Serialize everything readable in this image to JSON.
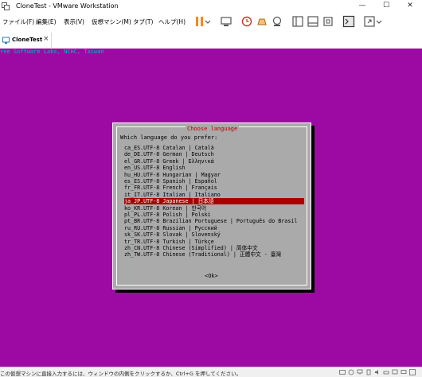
{
  "window": {
    "title": "CloneTest - VMware Workstation",
    "minimize": "—",
    "maximize": "☐",
    "close": "✕"
  },
  "menu": {
    "items": [
      "ファイル(F)",
      "編集(E)",
      "表示(V)",
      "仮想マシン(M)",
      "タブ(T)",
      "ヘルプ(H)"
    ]
  },
  "toolbar": {
    "icons": [
      "pause-icon",
      "dropdown-icon",
      "send-ctrl-alt-del-icon",
      "snapshot-icon",
      "revert-snapshot-icon",
      "manage-snapshots-icon",
      "show-library-icon",
      "thumbnail-icon",
      "fullscreen-icon",
      "console-view-icon",
      "unity-icon"
    ]
  },
  "tabs": [
    {
      "label": "CloneTest",
      "close": "×"
    }
  ],
  "vm": {
    "top_line": "ree Software Labs, NCHC, Taiwan",
    "dialog": {
      "title": "Choose language",
      "prompt": "Which language do you prefer:",
      "items": [
        "ca_ES.UTF-8 Catalan | Català",
        "de_DE.UTF-8 German | Deutsch",
        "el_GR.UTF-8 Greek | Ελληνικά",
        "en_US.UTF-8 English",
        "hu_HU.UTF-8 Hungarian | Magyar",
        "es_ES.UTF-8 Spanish | Español",
        "fr_FR.UTF-8 French | Français",
        "it_IT.UTF-8 Italian | Italiano",
        "ja_JP.UTF-8 Japanese | 日本語",
        "ko_KR.UTF-8 Korean | 한국어",
        "pl_PL.UTF-8 Polish | Polski",
        "pt_BR.UTF-8 Brazilian Portuguese | Português do Brasil",
        "ru_RU.UTF-8 Russian | Русский",
        "sk_SK.UTF-8 Slovak | Slovenský",
        "tr_TR.UTF-8 Turkish | Türkçe",
        "zh_CN.UTF-8 Chinese (Simplified) | 简体中文",
        "zh_TW.UTF-8 Chinese (Traditional) | 正體中文 - 臺灣"
      ],
      "selected_index": 8,
      "ok_label": "<Ok>"
    }
  },
  "statusbar": {
    "text": "この仮想マシンに直接入力するには、ウィンドウの内側をクリックするか、Ctrl+G を押してください。"
  },
  "colors": {
    "vm_background": "#9c0aa3",
    "dialog_background": "#aaaaaa",
    "selection": "#a80000",
    "dialog_title": "#c00000",
    "toolbar_orange": "#f08a24"
  }
}
